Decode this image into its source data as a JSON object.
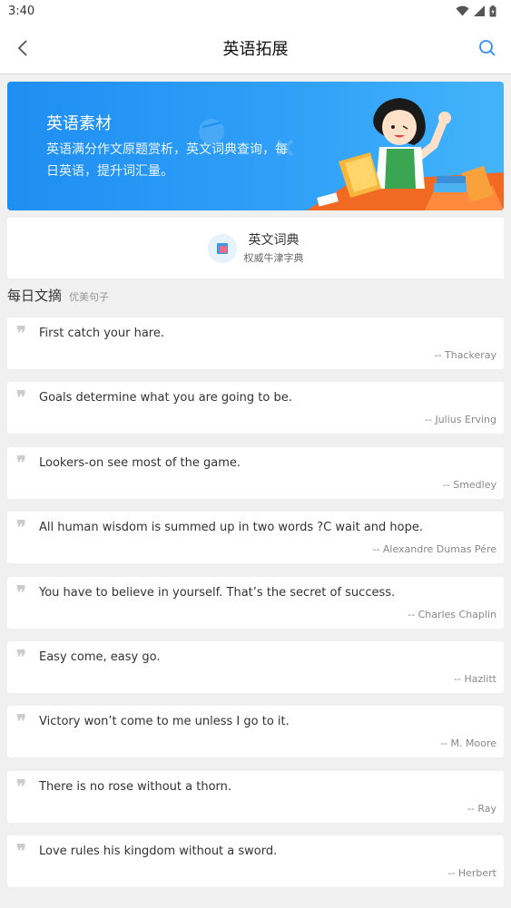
{
  "status": {
    "time": "3:40"
  },
  "header": {
    "title": "英语拓展"
  },
  "banner": {
    "title": "英语素材",
    "description": "英语满分作文原题赏析，英文词典查询，每日英语，提升词汇量。"
  },
  "dictionary": {
    "title": "英文词典",
    "subtitle": "权威牛津字典"
  },
  "section": {
    "title": "每日文摘",
    "subtitle": "优美句子"
  },
  "quotes": [
    {
      "text": "First catch your hare.",
      "author": "-- Thackeray"
    },
    {
      "text": "Goals determine what you are going to be.",
      "author": "-- Julius Erving"
    },
    {
      "text": "Lookers-on see most of the game.",
      "author": "-- Smedley"
    },
    {
      "text": "All human wisdom is summed up in two words ?C wait and hope.",
      "author": "-- Alexandre Dumas Pére"
    },
    {
      "text": "You have to believe in yourself. That’s the secret of success.",
      "author": "-- Charles Chaplin"
    },
    {
      "text": "Easy come, easy go.",
      "author": "-- Hazlitt"
    },
    {
      "text": "Victory won’t come to me unless I go to it.",
      "author": "-- M. Moore"
    },
    {
      "text": "There is no rose without a thorn.",
      "author": "-- Ray"
    },
    {
      "text": "Love rules his kingdom without a sword.",
      "author": "-- Herbert"
    }
  ],
  "colors": {
    "accent": "#1e8ff2",
    "background": "#f0f0f0"
  },
  "icons": [
    "back-arrow-icon",
    "search-icon",
    "book-icon",
    "quote-icon",
    "wifi-icon",
    "signal-icon",
    "battery-icon"
  ]
}
